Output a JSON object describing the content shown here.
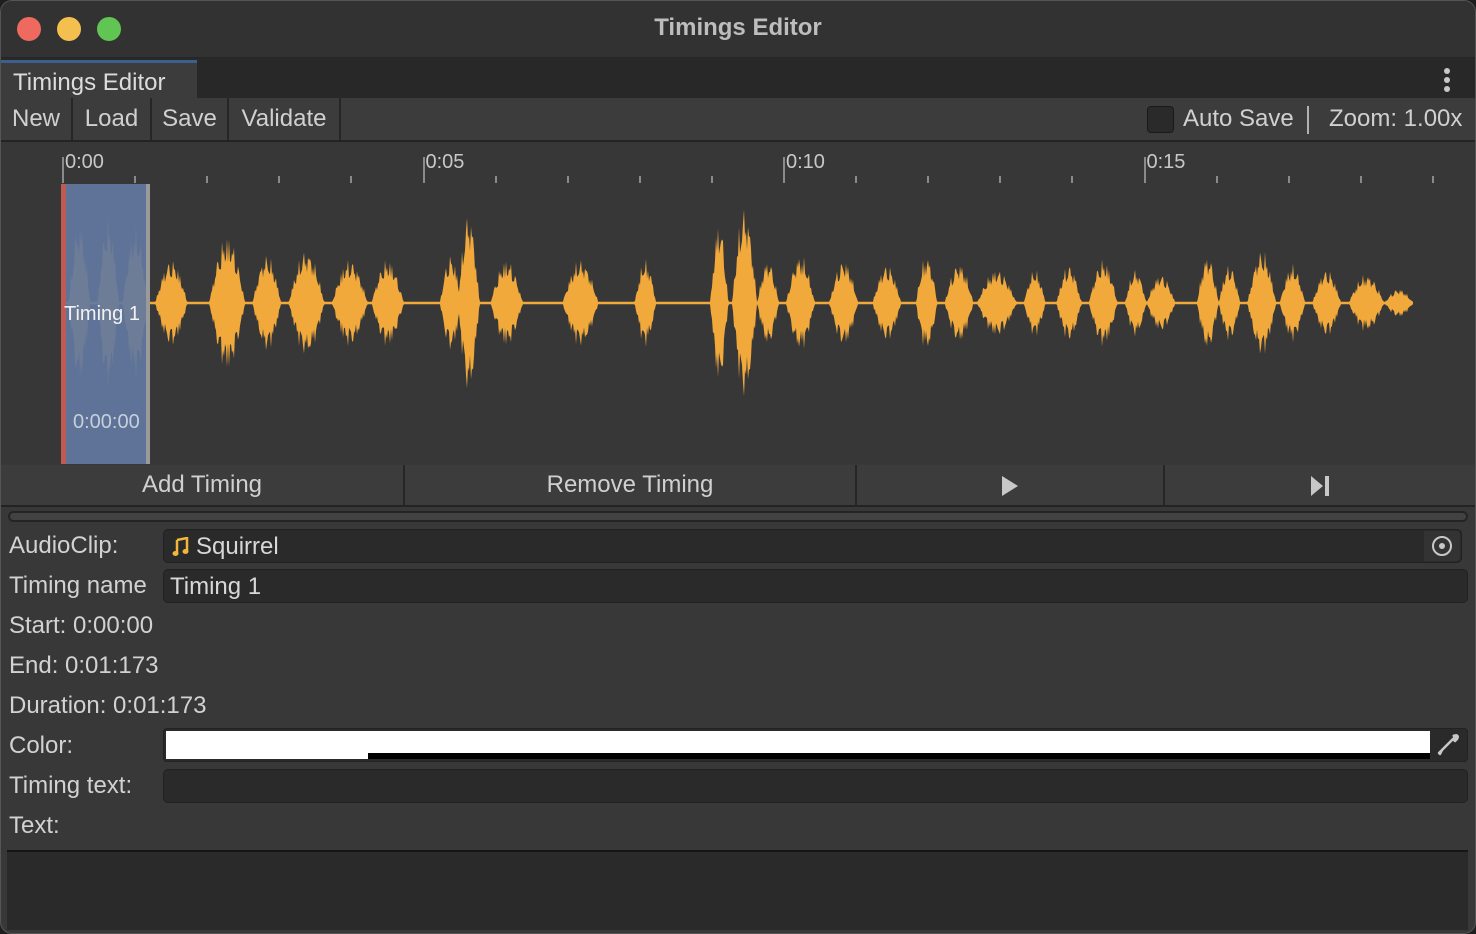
{
  "window": {
    "title": "Timings Editor",
    "traffic_lights": [
      "close",
      "minimize",
      "maximize"
    ]
  },
  "tab": {
    "label": "Timings Editor",
    "menu_icon": "kebab-menu-icon"
  },
  "toolbar": {
    "buttons": [
      {
        "label": "New"
      },
      {
        "label": "Load"
      },
      {
        "label": "Save"
      },
      {
        "label": "Validate"
      }
    ],
    "auto_save_label": "Auto Save",
    "auto_save_checked": false,
    "zoom_label": "Zoom: 1.00x"
  },
  "timeline": {
    "ruler_labels": [
      "0:00",
      "0:05",
      "0:10",
      "0:15"
    ],
    "major_tick_seconds": 5,
    "minor_ticks_per_major": 5,
    "clip_length_seconds": 18.7,
    "waveform_color": "#f2a93b",
    "region": {
      "name": "Timing 1",
      "start_label": "0:00:00",
      "start_seconds": 0.0,
      "end_seconds": 1.173,
      "fill_color": "#62789f",
      "start_marker_color": "#c05a55"
    }
  },
  "actions": {
    "add_label": "Add Timing",
    "remove_label": "Remove Timing",
    "play_icon": "play-icon",
    "skip_icon": "skip-to-end-icon"
  },
  "inspector": {
    "audioclip_label": "AudioClip:",
    "audioclip_value": "Squirrel",
    "timing_name_label": "Timing name",
    "timing_name_value": "Timing 1",
    "start_text": "Start: 0:00:00",
    "end_text": "End: 0:01:173",
    "duration_text": "Duration: 0:01:173",
    "color_label": "Color:",
    "color_value": "#ffffff",
    "color_alpha_fraction": 0.16,
    "timing_text_label": "Timing text:",
    "timing_text_value": "",
    "text_label": "Text:",
    "text_value": ""
  }
}
